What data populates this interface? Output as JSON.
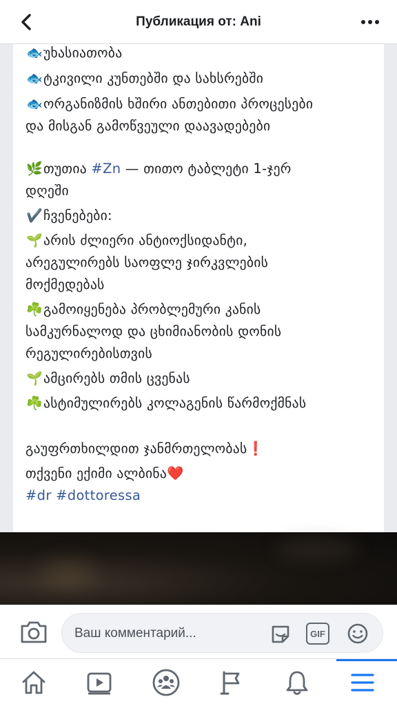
{
  "header": {
    "title": "Публикация от: Ani",
    "back_icon": "chevron-left-icon",
    "more_icon": "ellipsis-icon"
  },
  "post": {
    "lines": [
      {
        "emoji": "🐟",
        "text": "უხასიათობა"
      },
      {
        "emoji": "🐟",
        "text": "ტკივილი კუნთებში და სახსრებში"
      },
      {
        "emoji": "🐟",
        "text": "ორგანიზმის ხშირი ანთებითი პროცესები"
      },
      {
        "emoji": "",
        "text": "და მისგან გამოწვეული დაავადებები"
      }
    ],
    "zinc_emoji": "🌿",
    "zinc_before": "თუთია ",
    "zinc_tag": "#Zn",
    "zinc_after": " — თითო ტაბლეტი 1-ჯერ",
    "zinc_line2": "დღეში",
    "indications_emoji": "✔️",
    "indications_label": "ჩვენებები:",
    "indications": [
      {
        "emoji": "🌱",
        "lines": [
          "არის ძლიერი ანტიოქსიდანტი,",
          "არეგულირებს საოფლე ჯირკვლების",
          "მოქმედებას"
        ]
      },
      {
        "emoji": "☘️",
        "lines": [
          "გამოიყენება პრობლემური კანის",
          "სამკურნალოდ და ცხიმიანობის დონის",
          "რეგულირებისთვის"
        ]
      },
      {
        "emoji": "🌱",
        "lines": [
          "ამცირებს თმის ცვენას"
        ]
      },
      {
        "emoji": "☘️",
        "lines": [
          "ასტიმულირებს კოლაგენის წარმოქმნას"
        ]
      }
    ],
    "warning_text": "გაუფრთხილდით ჯანმრთელობას",
    "warning_emoji": "❗",
    "signature_text": "თქვენი ექიმი ალბინა",
    "signature_emoji": "❤️",
    "hashtags": "#dr #dottoressa"
  },
  "comment_bar": {
    "placeholder": "Ваш комментарий...",
    "camera_icon": "camera-icon",
    "sticker_icon": "sticker-icon",
    "gif_label": "GIF",
    "emoji_icon": "smiley-icon"
  },
  "tabbar": {
    "tabs": [
      "home-icon",
      "watch-icon",
      "groups-icon",
      "pages-flag-icon",
      "notifications-bell-icon",
      "menu-icon"
    ],
    "active_tab": "menu-icon",
    "accent": "#1877f2"
  }
}
